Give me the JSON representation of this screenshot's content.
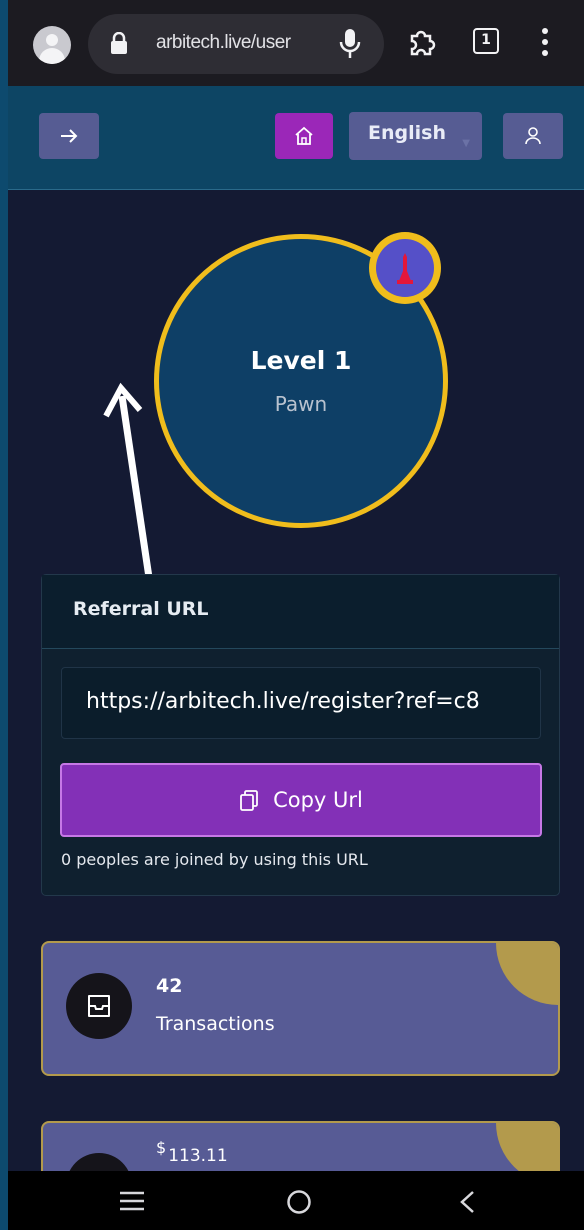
{
  "browser": {
    "url": "arbitech.live/user",
    "tab_count": "1"
  },
  "header": {
    "language": "English"
  },
  "level": {
    "title": "Level 1",
    "rank": "Pawn"
  },
  "referral": {
    "heading": "Referral URL",
    "url": "https://arbitech.live/register?ref=c8",
    "copy_label": "Copy Url",
    "joined_note": "0 peoples are joined by using this URL"
  },
  "stats": [
    {
      "value": "42",
      "label": "Transactions"
    },
    {
      "currency": "$",
      "value": "113.11"
    }
  ],
  "colors": {
    "accent_purple": "#8330b7",
    "gold": "#f0bd1c",
    "card_bg": "#575b95"
  }
}
